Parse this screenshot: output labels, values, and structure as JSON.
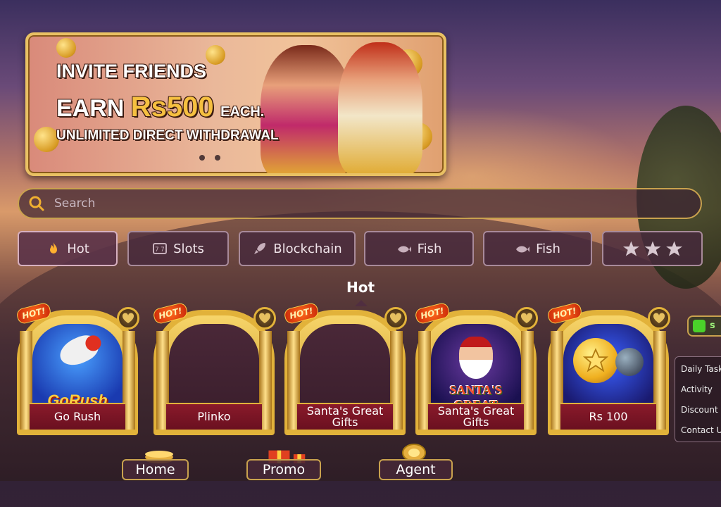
{
  "banner": {
    "line1": "INVITE FRIENDS",
    "line2_prefix": "EARN",
    "line2_amount": "Rs500",
    "line2_suffix": "EACH.",
    "line3": "UNLIMITED DIRECT WITHDRAWAL"
  },
  "search": {
    "placeholder": "Search"
  },
  "tabs": [
    {
      "label": "Hot",
      "icon": "flame-icon"
    },
    {
      "label": "Slots",
      "icon": "slots-icon"
    },
    {
      "label": "Blockchain",
      "icon": "rocket-icon"
    },
    {
      "label": "Fish",
      "icon": "fish-icon"
    },
    {
      "label": "Fish",
      "icon": "fish-icon"
    },
    {
      "label": "",
      "icon": "stars-icon"
    }
  ],
  "section_title": "Hot",
  "games": [
    {
      "name": "Go Rush",
      "badge": "HOT!",
      "art_text": "GoRush"
    },
    {
      "name": "Plinko",
      "badge": "HOT!"
    },
    {
      "name": "Santa's Great Gifts",
      "badge": "HOT!"
    },
    {
      "name": "Santa's Great Gifts",
      "badge": "HOT!",
      "art_text": "SANTA'S GREAT GIFTS"
    },
    {
      "name": "Rs 100",
      "badge": "HOT!"
    }
  ],
  "side_toggle_text": "s",
  "side_menu": [
    "Daily Task",
    "Activity",
    "Discount",
    "Contact U"
  ],
  "bottom_nav": [
    {
      "label": "Home"
    },
    {
      "label": "Promo"
    },
    {
      "label": "Agent"
    }
  ],
  "colors": {
    "gold": "#e2b23a",
    "plate": "#8a1a2a",
    "accent_amount": "#f6c040"
  }
}
